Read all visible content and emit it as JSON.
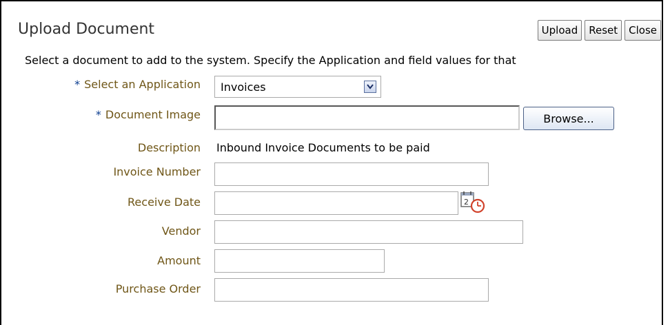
{
  "header": {
    "title": "Upload Document",
    "buttons": {
      "upload": "Upload",
      "reset": "Reset",
      "close": "Close"
    }
  },
  "instructions": "Select a document to add to the system. Specify the Application and field values for that",
  "form": {
    "application": {
      "label": "Select an Application",
      "required_marker": "*",
      "value": "Invoices"
    },
    "document_image": {
      "label": "Document Image",
      "required_marker": "*",
      "value": "",
      "browse_label": "Browse..."
    },
    "description": {
      "label": "Description",
      "value": "Inbound Invoice Documents to be paid"
    },
    "invoice_number": {
      "label": "Invoice Number",
      "value": ""
    },
    "receive_date": {
      "label": "Receive Date",
      "value": "",
      "picker_icon": "calendar-clock-icon"
    },
    "vendor": {
      "label": "Vendor",
      "value": ""
    },
    "amount": {
      "label": "Amount",
      "value": ""
    },
    "purchase_order": {
      "label": "Purchase Order",
      "value": ""
    }
  },
  "colors": {
    "label": "#6f5617",
    "required": "#0a3c8f",
    "title": "#333333"
  }
}
